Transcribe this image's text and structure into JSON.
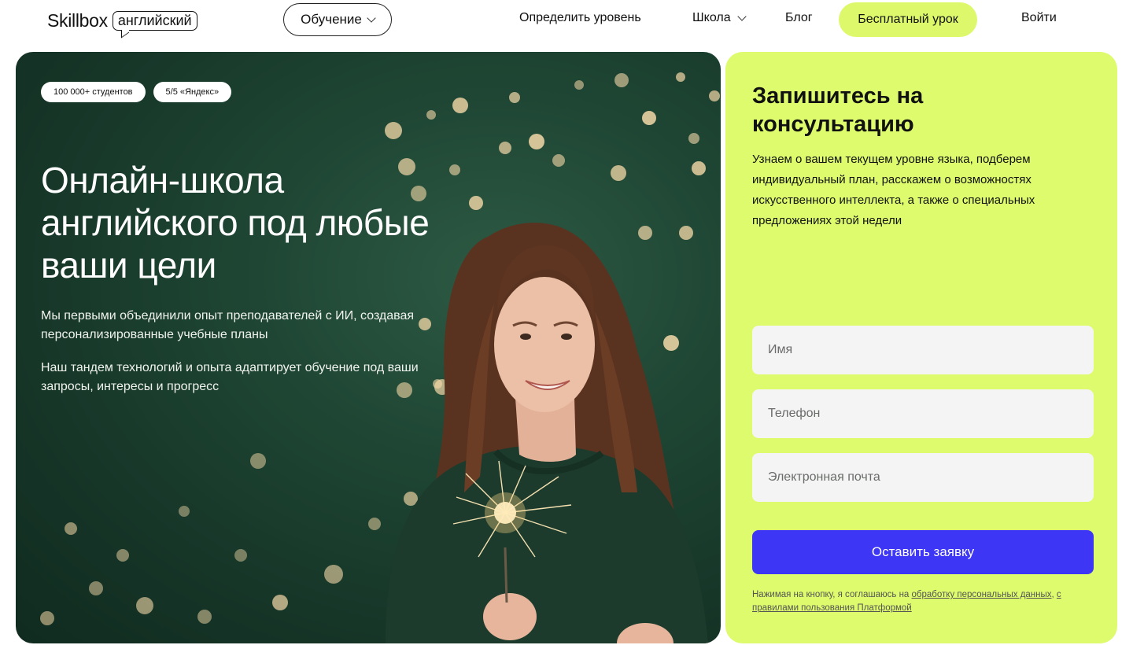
{
  "header": {
    "logo_word": "Skillbox",
    "logo_tag": "английский",
    "learn_label": "Обучение",
    "nav": {
      "level": "Определить уровень",
      "school": "Школа",
      "blog": "Блог",
      "login": "Войти"
    },
    "free_lesson": "Бесплатный урок",
    "accent_color": "#ddf96b"
  },
  "hero": {
    "badges": [
      "100 000+ студентов",
      "5/5 «Яндекс»"
    ],
    "title": "Онлайн-школа английского под любые ваши цели",
    "paragraph1": "Мы первыми объединили опыт преподавателей с ИИ, создавая персонализированные учебные планы",
    "paragraph2": "Наш тандем технологий и опыта адаптирует обучение под ваши запросы, интересы и прогресс",
    "background_color": "#1f4634"
  },
  "form": {
    "title": "Запишитесь на консультацию",
    "description": "Узнаем о вашем текущем уровне языка, подберем индивидуальный план, расскажем о возможностях искусственного интеллекта, а также о специальных предложениях этой недели",
    "name_placeholder": "Имя",
    "phone_placeholder": "Телефон",
    "email_placeholder": "Электронная почта",
    "submit_label": "Оставить заявку",
    "legal_prefix": "Нажимая на кнопку, я соглашаюсь на ",
    "legal_link1": "обработку персональных данных",
    "legal_middle": ", ",
    "legal_link2": "с правилами пользования Платформой",
    "card_color": "#ddfb6c",
    "button_color": "#3d36f5"
  }
}
